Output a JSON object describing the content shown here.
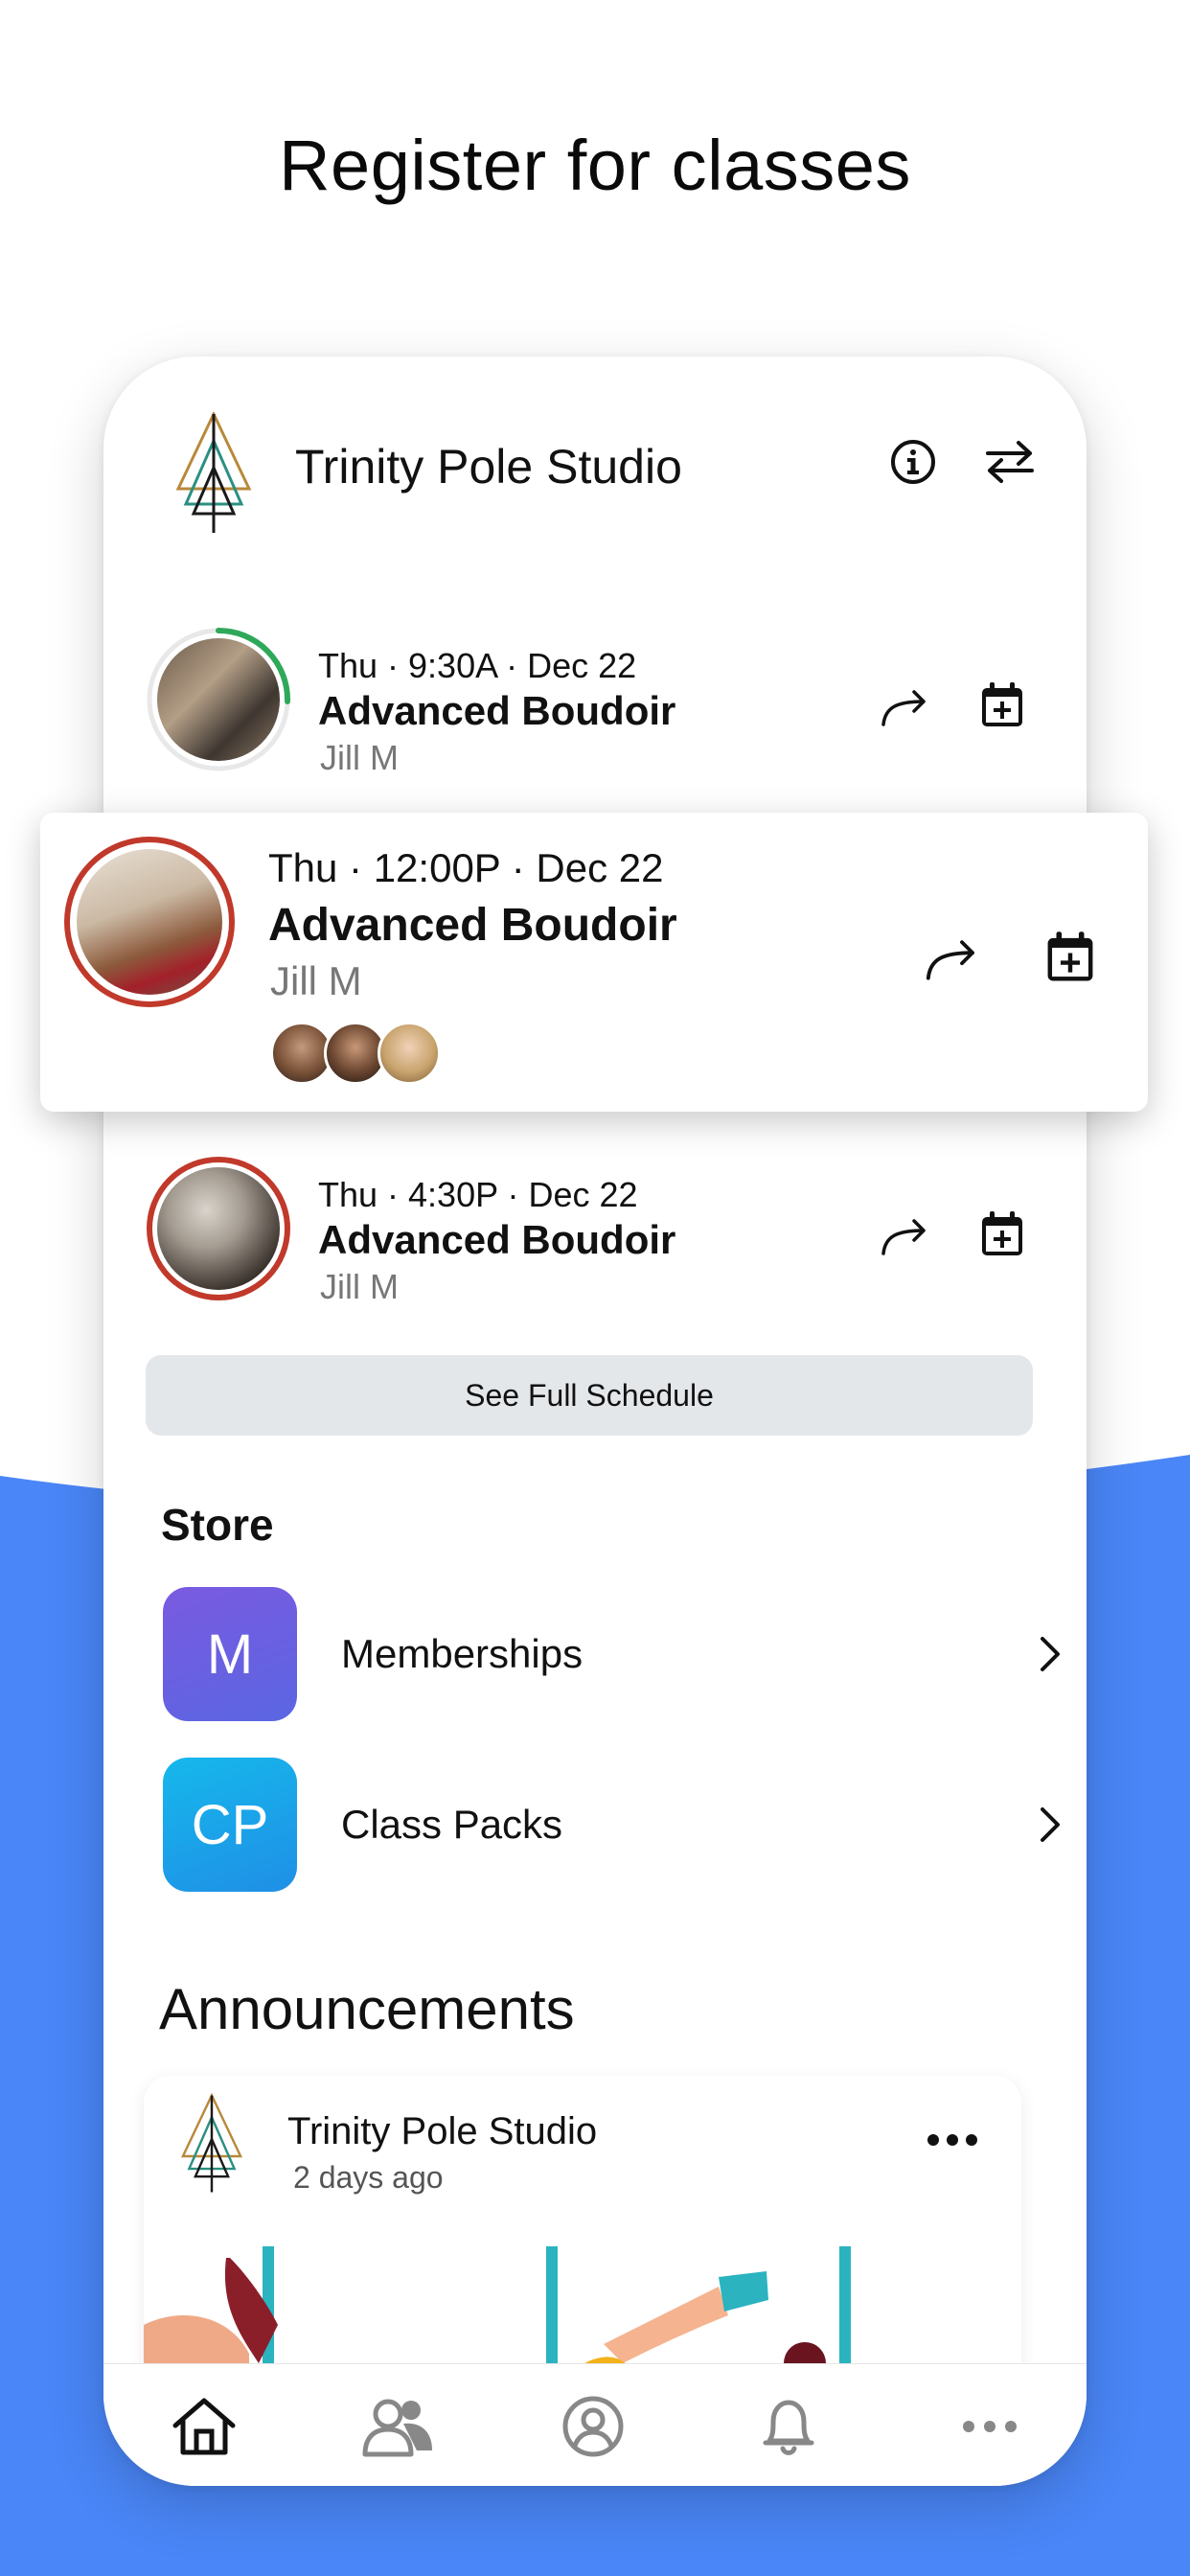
{
  "headline": "Register for classes",
  "colors": {
    "blue": "#4a86f7",
    "green_ring": "#2fa85a",
    "red_ring": "#c0392b",
    "memberships_badge": "#6a5be4",
    "classpacks_badge": "#1aa7e8"
  },
  "header": {
    "studio_name": "Trinity Pole Studio",
    "info_icon": "info-icon",
    "switch_icon": "switch-arrows-icon"
  },
  "classes": [
    {
      "time": "Thu · 9:30A · Dec 22",
      "name": "Advanced Boudoir",
      "instructor": "Jill M",
      "ring": "green"
    },
    {
      "time": "Thu · 12:00P · Dec 22",
      "name": "Advanced Boudoir",
      "instructor": "Jill M",
      "ring": "red",
      "highlighted": true
    },
    {
      "time": "Thu · 4:30P · Dec 22",
      "name": "Advanced Boudoir",
      "instructor": "Jill M",
      "ring": "red"
    }
  ],
  "see_full_schedule": "See Full Schedule",
  "store": {
    "title": "Store",
    "items": [
      {
        "badge": "M",
        "label": "Memberships"
      },
      {
        "badge": "CP",
        "label": "Class Packs"
      }
    ]
  },
  "announcements": {
    "title": "Announcements",
    "post": {
      "author": "Trinity Pole Studio",
      "time": "2 days ago"
    }
  },
  "tabbar": [
    "home-icon",
    "people-icon",
    "profile-icon",
    "bell-icon",
    "more-icon"
  ]
}
